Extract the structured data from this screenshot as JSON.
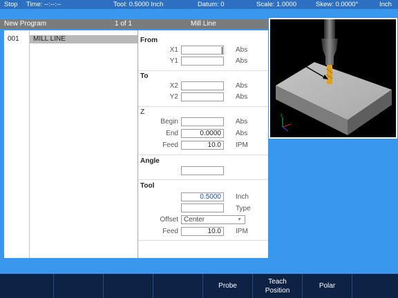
{
  "status_bar": {
    "mode": "Stop",
    "time": "Time: --:--:--",
    "tool": "Tool: 0.5000 Inch",
    "datum": "Datum: 0",
    "scale": "Scale: 1.0000",
    "skew": "Skew: 0.0000°",
    "units": "Inch"
  },
  "title_bar": {
    "program": "New Program",
    "page": "1 of 1",
    "operation": "Mill Line"
  },
  "program_list": [
    {
      "number": "001",
      "name": "MILL LINE"
    }
  ],
  "form": {
    "from": {
      "title": "From",
      "x1": {
        "label": "X1",
        "value": "",
        "unit": "Abs"
      },
      "y1": {
        "label": "Y1",
        "value": "",
        "unit": "Abs"
      }
    },
    "to": {
      "title": "To",
      "x2": {
        "label": "X2",
        "value": "",
        "unit": "Abs"
      },
      "y2": {
        "label": "Y2",
        "value": "",
        "unit": "Abs"
      }
    },
    "z": {
      "title": "Z",
      "begin": {
        "label": "Begin",
        "value": "",
        "unit": "Abs"
      },
      "end": {
        "label": "End",
        "value": "0.0000",
        "unit": "Abs"
      },
      "feed": {
        "label": "Feed",
        "value": "10.0",
        "unit": "IPM"
      }
    },
    "angle": {
      "title": "Angle",
      "value": ""
    },
    "tool": {
      "title": "Tool",
      "diameter": {
        "value": "0.5000",
        "unit": "Inch"
      },
      "type": {
        "value": "",
        "unit": "Type"
      },
      "offset": {
        "label": "Offset",
        "value": "Center"
      },
      "feed": {
        "label": "Feed",
        "value": "10.0",
        "unit": "IPM"
      }
    }
  },
  "softkeys": [
    "",
    "",
    "",
    "",
    "Probe",
    "Teach\nPosition",
    "Polar",
    ""
  ],
  "colors": {
    "background": "#3a97ee",
    "status_bar": "#2d6fc0",
    "title_bar": "#7b7b7b",
    "softkey_bar": "#0e2245",
    "selected_row": "#b9b9b9",
    "tool_tip": "#e0a020"
  }
}
